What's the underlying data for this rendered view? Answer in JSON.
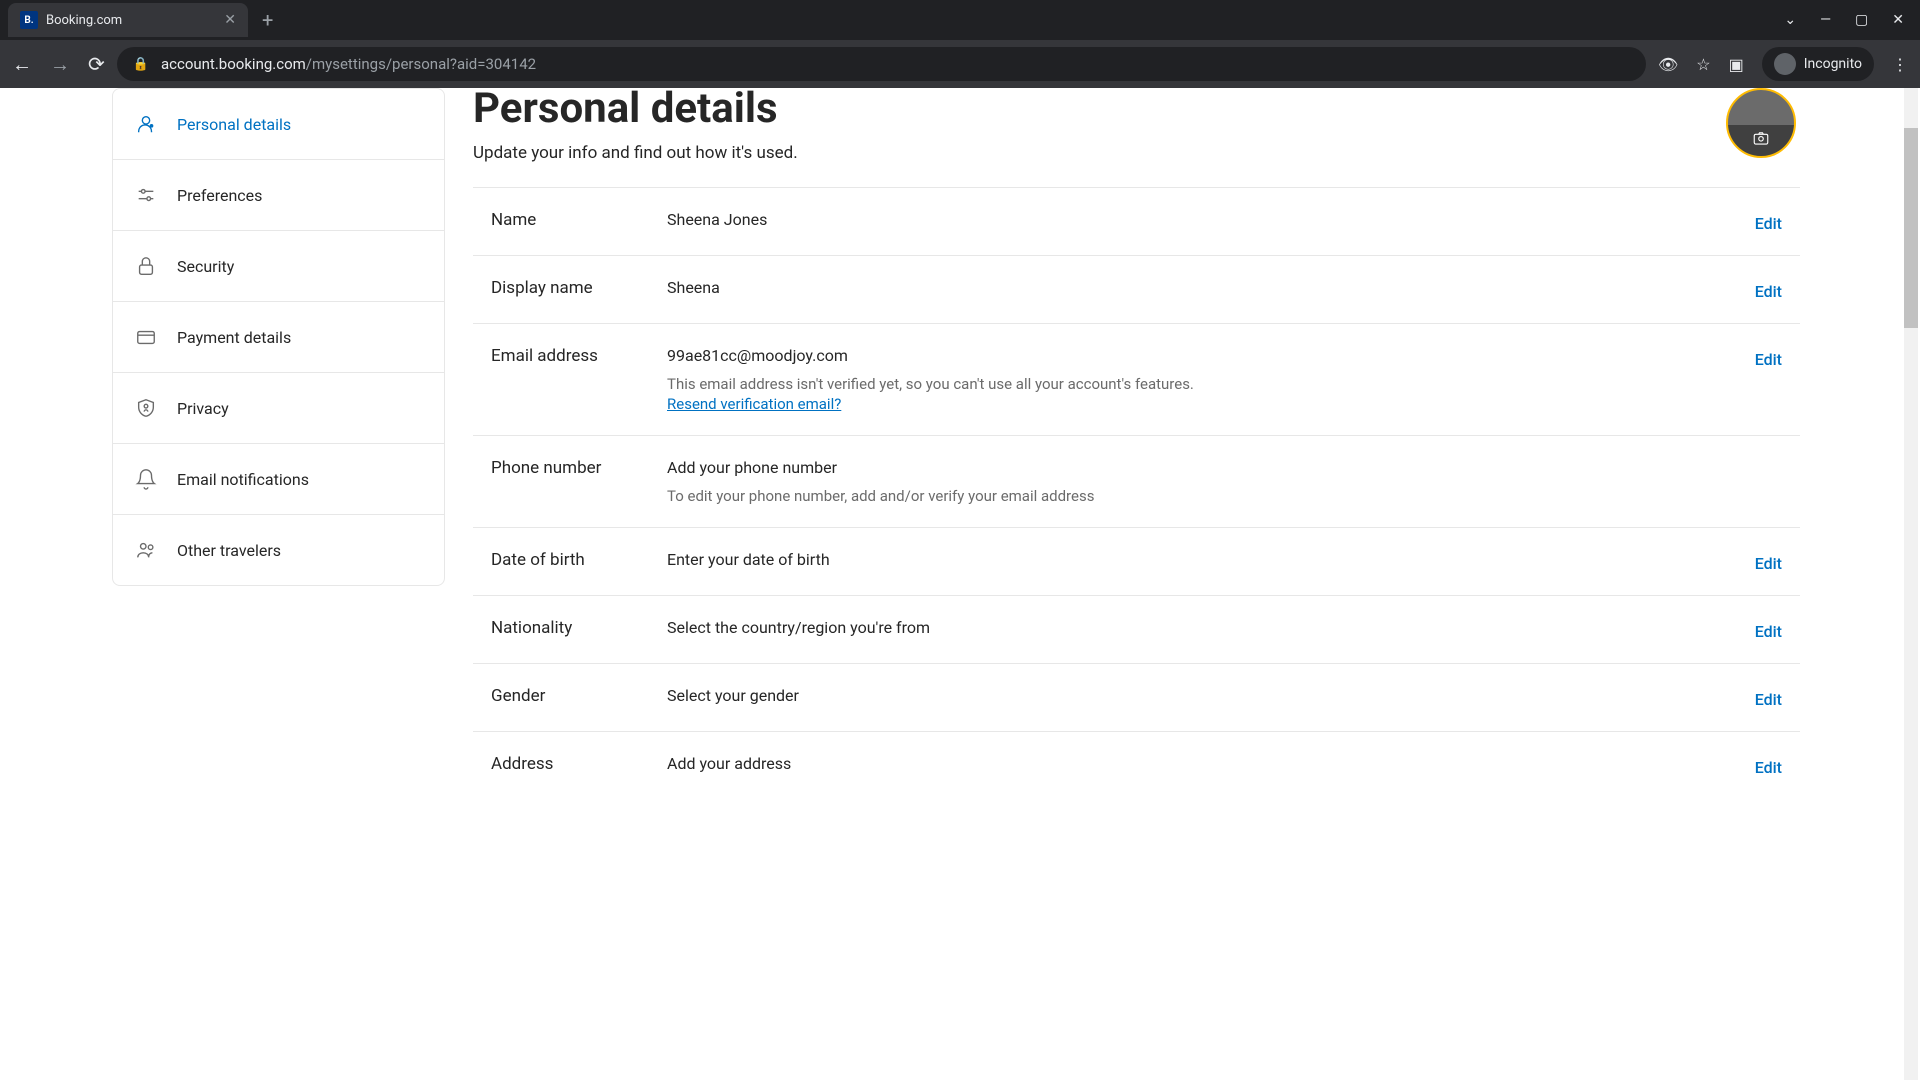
{
  "browser": {
    "tab_title": "Booking.com",
    "favicon_text": "B.",
    "url_host": "account.booking.com",
    "url_path": "/mysettings/personal?aid=304142",
    "incognito_label": "Incognito"
  },
  "sidebar": {
    "items": [
      {
        "label": "Personal details"
      },
      {
        "label": "Preferences"
      },
      {
        "label": "Security"
      },
      {
        "label": "Payment details"
      },
      {
        "label": "Privacy"
      },
      {
        "label": "Email notifications"
      },
      {
        "label": "Other travelers"
      }
    ]
  },
  "page": {
    "title": "Personal details",
    "subtitle": "Update your info and find out how it's used."
  },
  "rows": {
    "name": {
      "label": "Name",
      "value": "Sheena Jones",
      "edit": "Edit"
    },
    "display_name": {
      "label": "Display name",
      "value": "Sheena",
      "edit": "Edit"
    },
    "email": {
      "label": "Email address",
      "value": "99ae81cc@moodjoy.com",
      "subtext": "This email address isn't verified yet, so you can't use all your account's features.",
      "link": "Resend verification email?",
      "edit": "Edit"
    },
    "phone": {
      "label": "Phone number",
      "value": "Add your phone number",
      "subtext": "To edit your phone number, add and/or verify your email address"
    },
    "dob": {
      "label": "Date of birth",
      "value": "Enter your date of birth",
      "edit": "Edit"
    },
    "nationality": {
      "label": "Nationality",
      "value": "Select the country/region you're from",
      "edit": "Edit"
    },
    "gender": {
      "label": "Gender",
      "value": "Select your gender",
      "edit": "Edit"
    },
    "address": {
      "label": "Address",
      "value": "Add your address",
      "edit": "Edit"
    }
  }
}
